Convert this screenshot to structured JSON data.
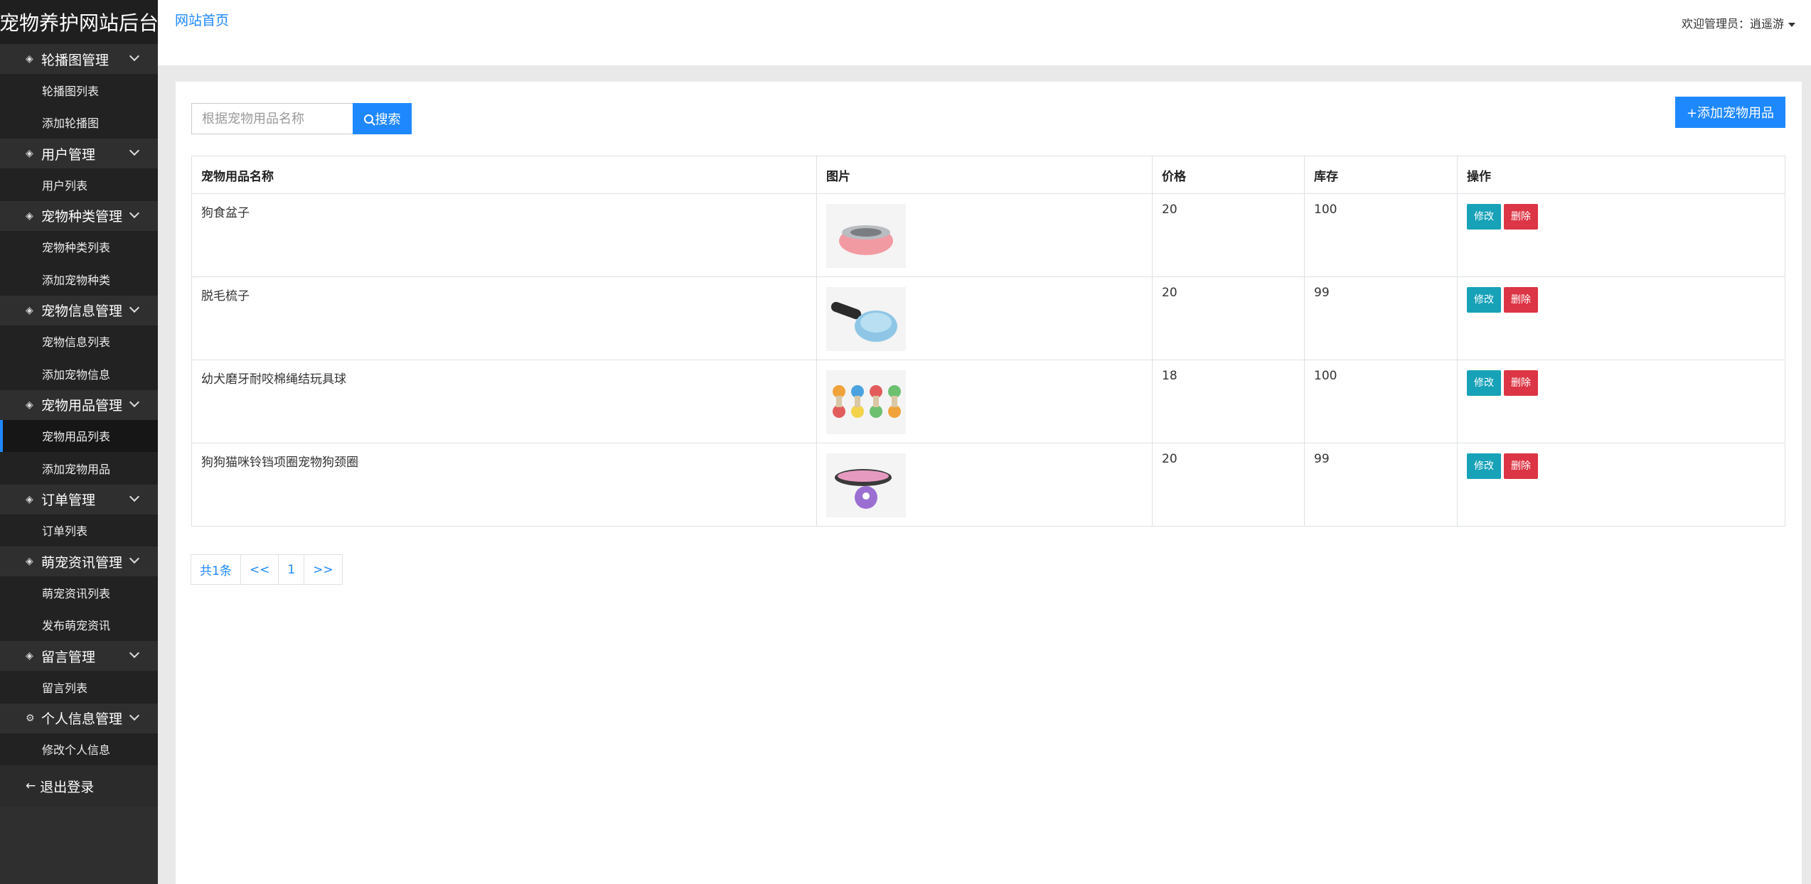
{
  "sidebar": {
    "brand": "宠物养护网站后台",
    "groups": [
      {
        "title": "轮播图管理",
        "items": [
          "轮播图列表",
          "添加轮播图"
        ]
      },
      {
        "title": "用户管理",
        "items": [
          "用户列表"
        ]
      },
      {
        "title": "宠物种类管理",
        "items": [
          "宠物种类列表",
          "添加宠物种类"
        ]
      },
      {
        "title": "宠物信息管理",
        "items": [
          "宠物信息列表",
          "添加宠物信息"
        ]
      },
      {
        "title": "宠物用品管理",
        "items": [
          "宠物用品列表",
          "添加宠物用品"
        ]
      },
      {
        "title": "订单管理",
        "items": [
          "订单列表"
        ]
      },
      {
        "title": "萌宠资讯管理",
        "items": [
          "萌宠资讯列表",
          "发布萌宠资讯"
        ]
      },
      {
        "title": "留言管理",
        "items": [
          "留言列表"
        ]
      },
      {
        "title": "个人信息管理",
        "items": [
          "修改个人信息"
        ]
      }
    ],
    "logout": "退出登录",
    "accent_color": "#1e88ff"
  },
  "header": {
    "home_link": "网站首页",
    "welcome": "欢迎管理员：逍遥游"
  },
  "toolbar": {
    "search_placeholder": "根据宠物用品名称",
    "search_label": "搜索",
    "add_label": "+添加宠物用品"
  },
  "table": {
    "headers": [
      "宠物用品名称",
      "图片",
      "价格",
      "库存",
      "操作"
    ],
    "rows": [
      {
        "name": "狗食盆子",
        "price": "20",
        "stock": "100",
        "edit": "修改",
        "delete": "删除"
      },
      {
        "name": "脱毛梳子",
        "price": "20",
        "stock": "99",
        "edit": "修改",
        "delete": "删除"
      },
      {
        "name": "幼犬磨牙耐咬棉绳结玩具球",
        "price": "18",
        "stock": "100",
        "edit": "修改",
        "delete": "删除"
      },
      {
        "name": "狗狗猫咪铃铛项圈宠物狗颈圈",
        "price": "20",
        "stock": "99",
        "edit": "修改",
        "delete": "删除"
      }
    ]
  },
  "pagination": {
    "total": "共1条",
    "prev": "<<",
    "page": "1",
    "next": ">>"
  }
}
